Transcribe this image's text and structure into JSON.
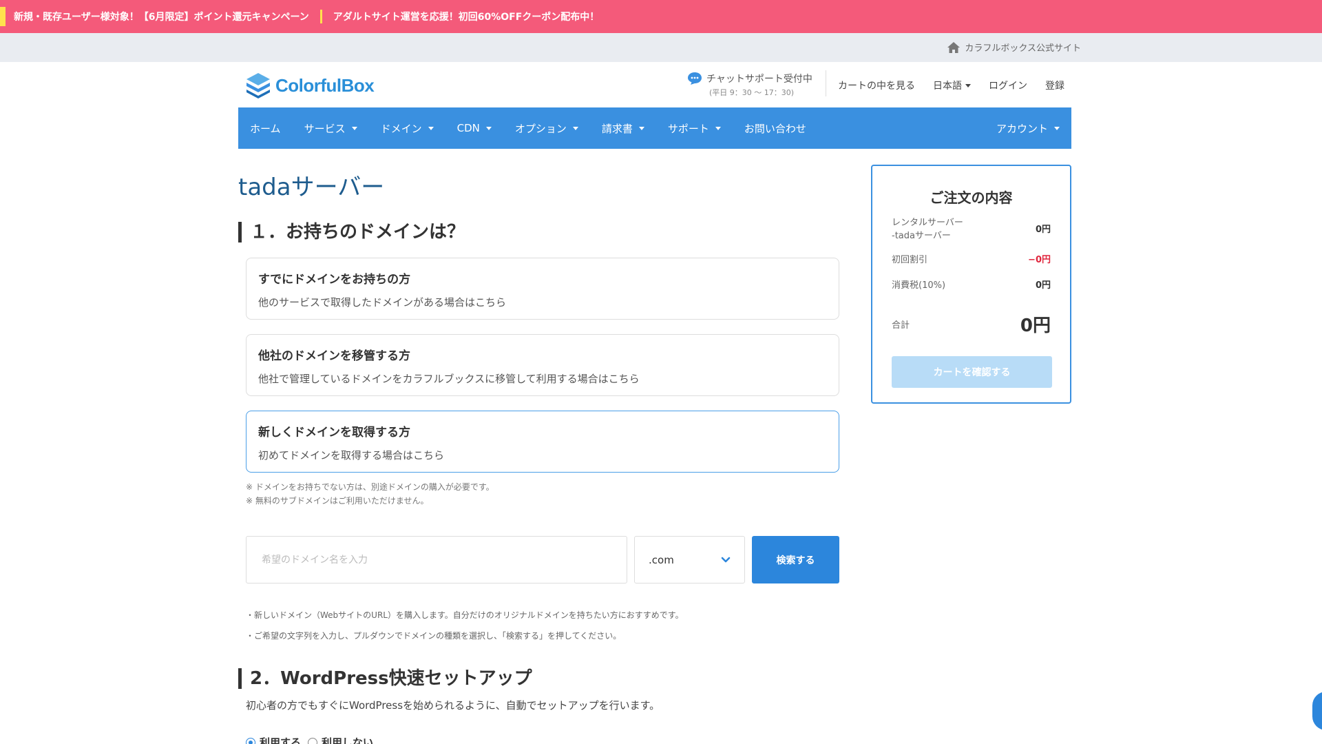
{
  "promo": {
    "item1": "新規・既存ユーザー様対象！【6月限定】ポイント還元キャンペーン",
    "item2": "アダルトサイト運営を応援！初回60%OFFクーポン配布中！"
  },
  "subbar": {
    "official_site": "カラフルボックス公式サイト"
  },
  "header": {
    "logo_text": "ColorfulBox",
    "chat_label": "チャットサポート受付中",
    "chat_hours": "(平日 9：30 〜 17：30)",
    "links": {
      "cart": "カートの中を見る",
      "language": "日本語",
      "login": "ログイン",
      "register": "登録"
    }
  },
  "nav": {
    "home": "ホーム",
    "service": "サービス",
    "domain": "ドメイン",
    "cdn": "CDN",
    "options": "オプション",
    "invoice": "請求書",
    "support": "サポート",
    "contact": "お問い合わせ",
    "account": "アカウント"
  },
  "page": {
    "title": "tadaサーバー"
  },
  "section1": {
    "heading": "１．お持ちのドメインは？",
    "options": [
      {
        "title": "すでにドメインをお持ちの方",
        "desc": "他のサービスで取得したドメインがある場合はこちら"
      },
      {
        "title": "他社のドメインを移管する方",
        "desc": "他社で管理しているドメインをカラフルブックスに移管して利用する場合はこちら"
      },
      {
        "title": "新しくドメインを取得する方",
        "desc": "初めてドメインを取得する場合はこちら"
      }
    ],
    "notes": [
      "※ ドメインをお持ちでない方は、別途ドメインの購入が必要です。",
      "※ 無料のサブドメインはご利用いただけません。"
    ],
    "search": {
      "placeholder": "希望のドメイン名を入力",
      "value": "",
      "tld": ".com",
      "button": "検索する"
    },
    "bullets": [
      "・新しいドメイン（WebサイトのURL）を購入します。自分だけのオリジナルドメインを持ちたい方におすすめです。",
      "・ご希望の文字列を入力し、プルダウンでドメインの種類を選択し、「検索する」を押してください。"
    ]
  },
  "section2": {
    "heading": "2．WordPress快速セットアップ",
    "desc": "初心者の方でもすぐにWordPressを始められるように、自動でセットアップを行います。",
    "options": {
      "use": "利用する",
      "not_use": "利用しない"
    }
  },
  "order": {
    "title": "ご注文の内容",
    "item_name_1": "レンタルサーバー",
    "item_name_2": "-tadaサーバー",
    "item_price": "0円",
    "discount_label": "初回割引",
    "discount_value": "−0円",
    "tax_label": "消費税(10%)",
    "tax_value": "0円",
    "total_label": "合計",
    "total_value": "0円",
    "button": "カートを確認する"
  },
  "colors": {
    "brand": "#3a90e0",
    "promo": "#f45a7a",
    "accent_yellow": "#ffe14d",
    "danger": "#e0263d"
  }
}
